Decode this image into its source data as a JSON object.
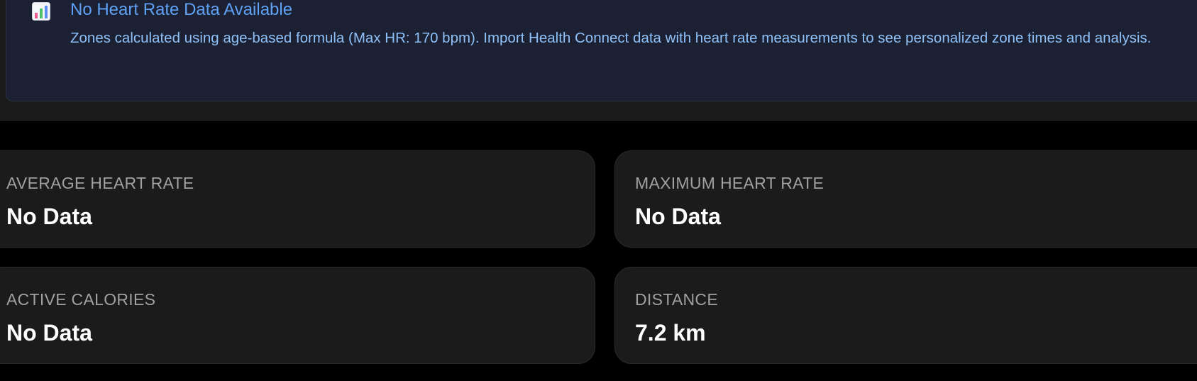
{
  "banner": {
    "icon": "bar-chart-icon",
    "title": "No Heart Rate Data Available",
    "text": "Zones calculated using age-based formula (Max HR: 170 bpm). Import Health Connect data with heart rate measurements to see personalized zone times and analysis."
  },
  "stats": [
    {
      "label": "AVERAGE HEART RATE",
      "value": "No Data"
    },
    {
      "label": "MAXIMUM HEART RATE",
      "value": "No Data"
    },
    {
      "label": "ACTIVE CALORIES",
      "value": "No Data"
    },
    {
      "label": "DISTANCE",
      "value": "7.2 km"
    }
  ],
  "colors": {
    "page_background": "#000000",
    "card_background": "#1b1b1b",
    "banner_background": "#1b2032",
    "banner_title": "#5fa1f4",
    "banner_text": "#8fc0f7",
    "stat_label": "#a0a0a0",
    "stat_value": "#ffffff"
  }
}
